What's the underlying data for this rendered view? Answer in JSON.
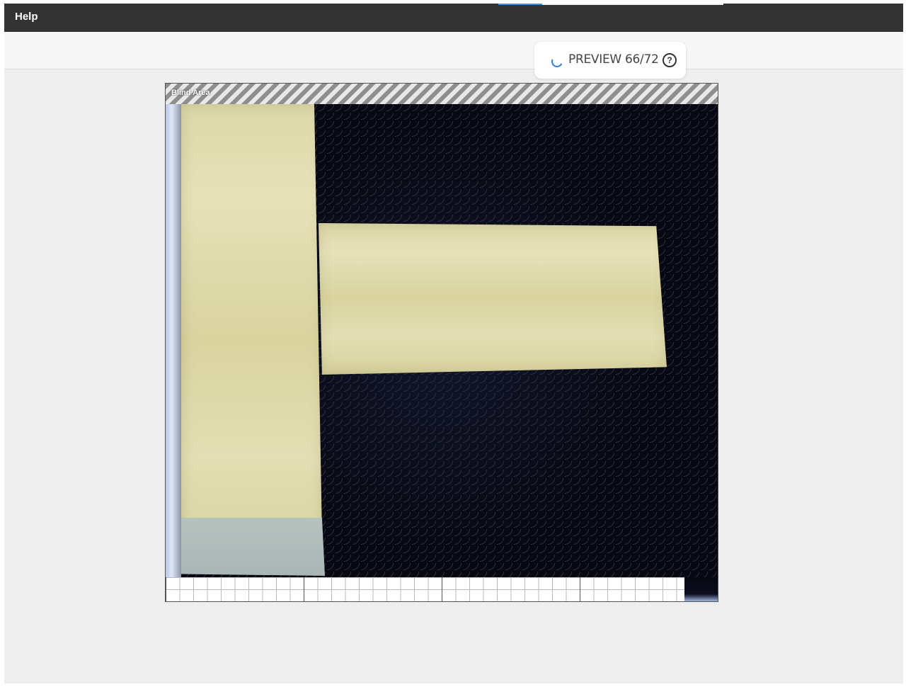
{
  "menubar": {
    "help_label": "Help"
  },
  "preview": {
    "label": "PREVIEW 66/72",
    "help_icon_glyph": "?",
    "icon": "help-circle-icon",
    "spinner_icon": "loading-spinner-icon"
  },
  "canvas": {
    "blind_area_label": "Blind Area"
  },
  "colors": {
    "menubar_bg": "#333333",
    "accent": "#2f80d1",
    "workspace_bg": "#efefef"
  }
}
